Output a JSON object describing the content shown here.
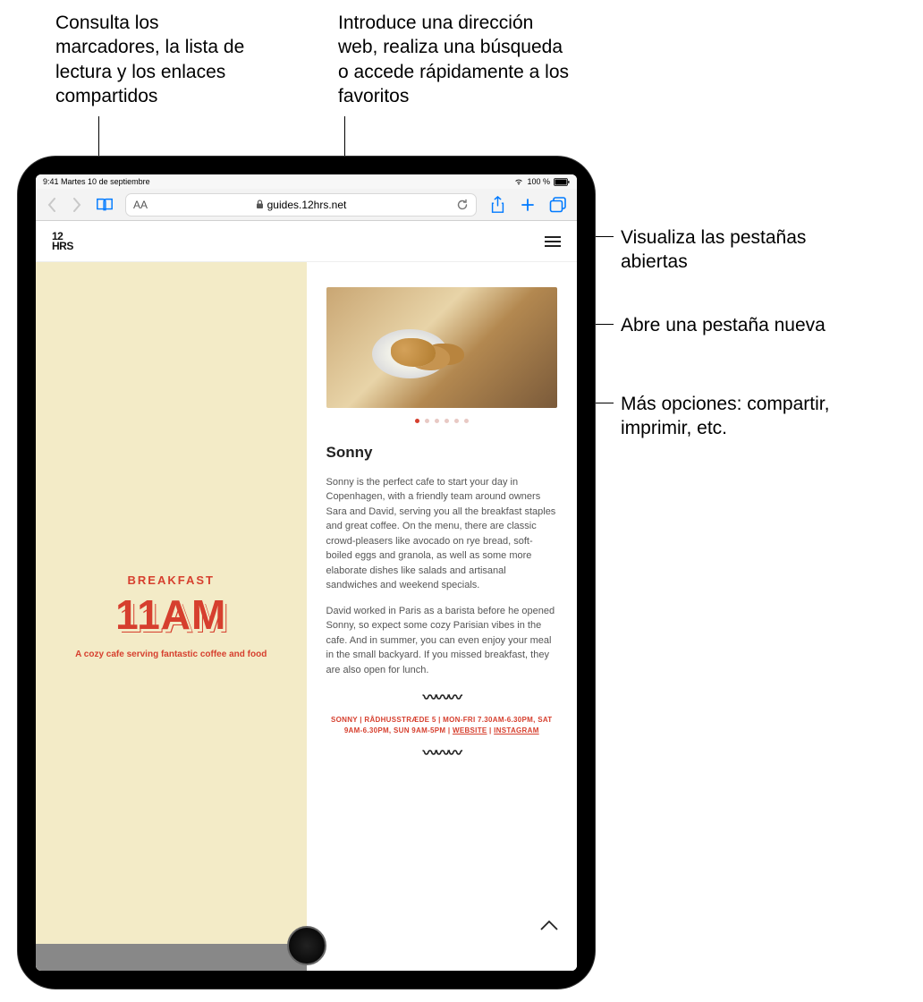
{
  "callouts": {
    "bookmarks": "Consulta los marcadores, la lista de lectura y los enlaces compartidos",
    "url": "Introduce una dirección web, realiza una búsqueda o accede rápidamente a los favoritos",
    "tabs": "Visualiza las pestañas abiertas",
    "newtab": "Abre una pestaña nueva",
    "share": "Más opciones: compartir, imprimir, etc."
  },
  "status": {
    "time": "9:41",
    "date": "Martes 10 de septiembre",
    "battery": "100 %"
  },
  "toolbar": {
    "aa": "AA",
    "url": "guides.12hrs.net"
  },
  "page": {
    "logo_top": "12",
    "logo_bot": "HRS",
    "left": {
      "label": "BREAKFAST",
      "time": "11AM",
      "subtitle": "A cozy cafe serving fantastic coffee and food"
    },
    "article": {
      "title": "Sonny",
      "p1": "Sonny is the perfect cafe to start your day in Copenhagen, with a friendly team around owners Sara and David, serving you all the breakfast staples and great coffee. On the menu, there are classic crowd-pleasers like avocado on rye bread, soft-boiled eggs and granola, as well as some more elaborate dishes like salads and artisanal sandwiches and weekend specials.",
      "p2": "David worked in Paris as a barista before he opened Sonny, so expect some cozy Parisian vibes in the cafe. And in summer, you can even enjoy your meal in the small backyard. If you missed breakfast, they are also open for lunch.",
      "footer1": "SONNY | RÅDHUSSTRÆDE 5 | MON-FRI 7.30AM-6.30PM, SAT",
      "footer2_a": "9AM-6.30PM, SUN 9AM-5PM | ",
      "footer2_b": "WEBSITE",
      "footer2_c": " | ",
      "footer2_d": "INSTAGRAM"
    }
  }
}
